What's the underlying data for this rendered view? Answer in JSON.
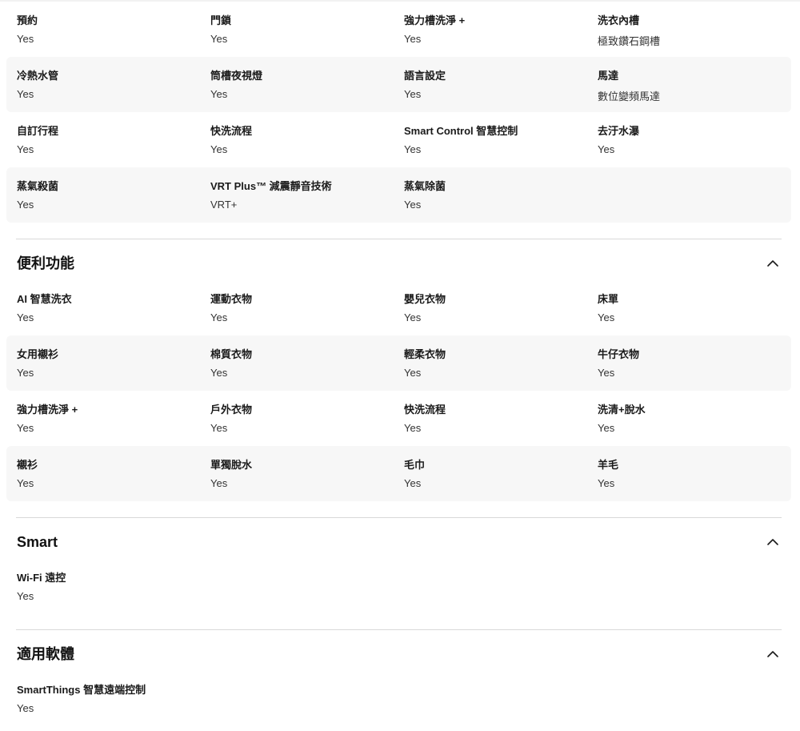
{
  "specs_top": {
    "rows": [
      [
        {
          "label": "預約",
          "value": "Yes"
        },
        {
          "label": "門鎖",
          "value": "Yes"
        },
        {
          "label": "強力槽洗淨 +",
          "value": "Yes"
        },
        {
          "label": "洗衣內槽",
          "value": "極致鑽石鋼槽"
        }
      ],
      [
        {
          "label": "冷熱水管",
          "value": "Yes"
        },
        {
          "label": "筒槽夜視燈",
          "value": "Yes"
        },
        {
          "label": "語言設定",
          "value": "Yes"
        },
        {
          "label": "馬達",
          "value": "數位變頻馬達"
        }
      ],
      [
        {
          "label": "自訂行程",
          "value": "Yes"
        },
        {
          "label": "快洗流程",
          "value": "Yes"
        },
        {
          "label": "Smart Control 智慧控制",
          "value": "Yes"
        },
        {
          "label": "去汙水瀑",
          "value": "Yes"
        }
      ],
      [
        {
          "label": "蒸氣殺菌",
          "value": "Yes"
        },
        {
          "label": "VRT Plus™ 減震靜音技術",
          "value": "VRT+"
        },
        {
          "label": "蒸氣除菌",
          "value": "Yes"
        },
        {
          "label": "",
          "value": ""
        }
      ]
    ]
  },
  "convenience": {
    "title": "便利功能",
    "rows": [
      [
        {
          "label": "AI 智慧洗衣",
          "value": "Yes"
        },
        {
          "label": "運動衣物",
          "value": "Yes"
        },
        {
          "label": "嬰兒衣物",
          "value": "Yes"
        },
        {
          "label": "床單",
          "value": "Yes"
        }
      ],
      [
        {
          "label": "女用襯衫",
          "value": "Yes"
        },
        {
          "label": "棉質衣物",
          "value": "Yes"
        },
        {
          "label": "輕柔衣物",
          "value": "Yes"
        },
        {
          "label": "牛仔衣物",
          "value": "Yes"
        }
      ],
      [
        {
          "label": "強力槽洗淨 +",
          "value": "Yes"
        },
        {
          "label": "戶外衣物",
          "value": "Yes"
        },
        {
          "label": "快洗流程",
          "value": "Yes"
        },
        {
          "label": "洗清+脫水",
          "value": "Yes"
        }
      ],
      [
        {
          "label": "襯衫",
          "value": "Yes"
        },
        {
          "label": "單獨脫水",
          "value": "Yes"
        },
        {
          "label": "毛巾",
          "value": "Yes"
        },
        {
          "label": "羊毛",
          "value": "Yes"
        }
      ]
    ]
  },
  "smart": {
    "title": "Smart",
    "rows": [
      [
        {
          "label": "Wi-Fi 遠控",
          "value": "Yes"
        }
      ]
    ]
  },
  "software": {
    "title": "適用軟體",
    "rows": [
      [
        {
          "label": "SmartThings 智慧遠端控制",
          "value": "Yes"
        }
      ]
    ]
  },
  "icons": {
    "collapse": "chevron-up-icon"
  }
}
